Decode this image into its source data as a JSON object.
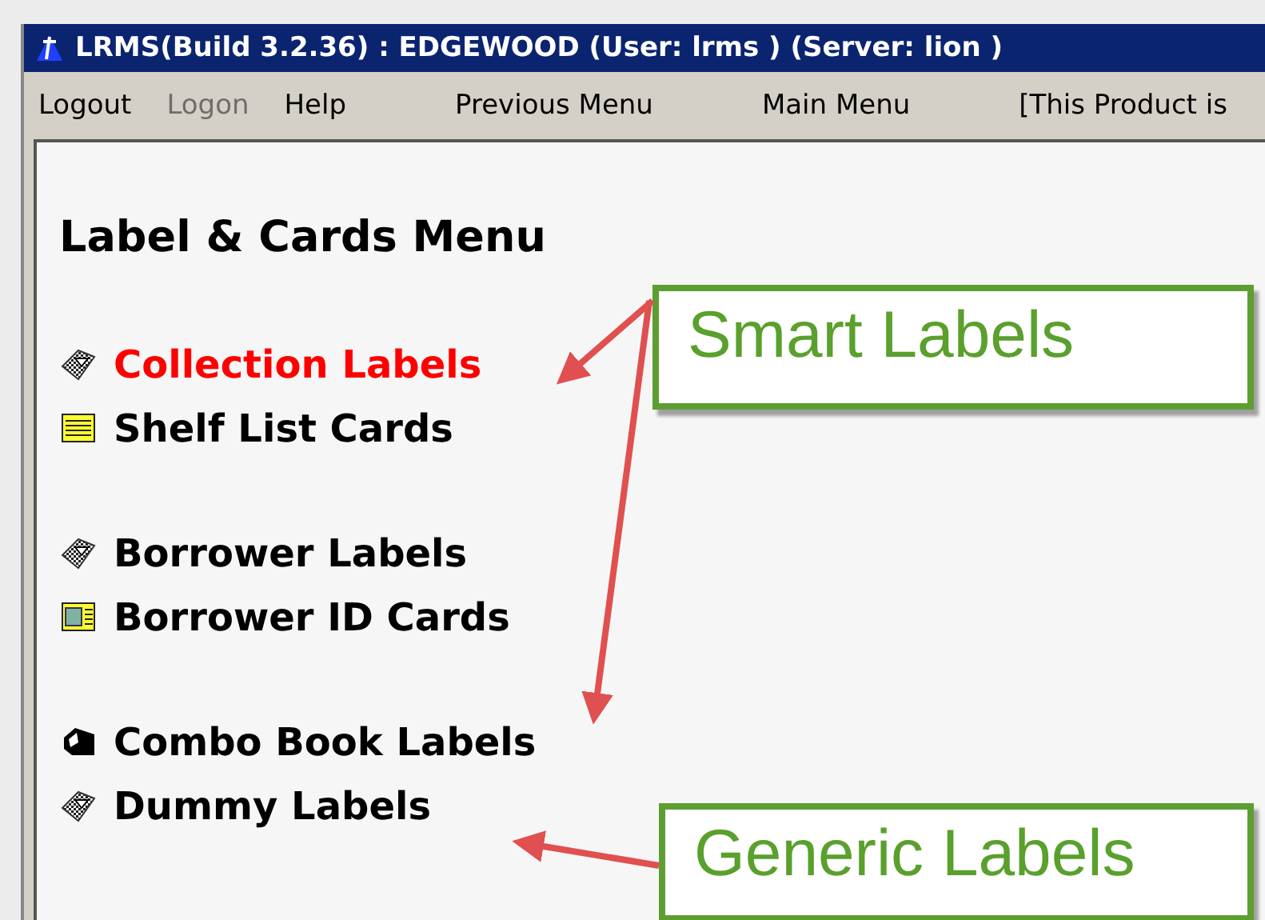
{
  "window": {
    "title": "LRMS(Build 3.2.36) : EDGEWOOD (User: lrms ) (Server: lion )"
  },
  "menu_bar": [
    {
      "label": "Logout",
      "disabled": false
    },
    {
      "label": "Logon",
      "disabled": true
    },
    {
      "label": "Help",
      "disabled": false
    },
    {
      "label": "Previous Menu",
      "disabled": false
    },
    {
      "label": "Main Menu",
      "disabled": false
    },
    {
      "label": "[This Product is",
      "disabled": false
    }
  ],
  "page": {
    "heading": "Label & Cards Menu",
    "groups": [
      {
        "items": [
          {
            "label": "Collection Labels",
            "kind": "label",
            "selected": true
          },
          {
            "label": "Shelf List Cards",
            "kind": "card",
            "selected": false
          }
        ]
      },
      {
        "items": [
          {
            "label": "Borrower Labels",
            "kind": "label",
            "selected": false
          },
          {
            "label": "Borrower ID Cards",
            "kind": "idcard",
            "selected": false
          }
        ]
      },
      {
        "items": [
          {
            "label": "Combo Book Labels",
            "kind": "book",
            "selected": false
          },
          {
            "label": "Dummy Labels",
            "kind": "label",
            "selected": false
          }
        ]
      }
    ]
  },
  "annotations": [
    {
      "text": "Smart Labels"
    },
    {
      "text": "Generic Labels"
    }
  ]
}
